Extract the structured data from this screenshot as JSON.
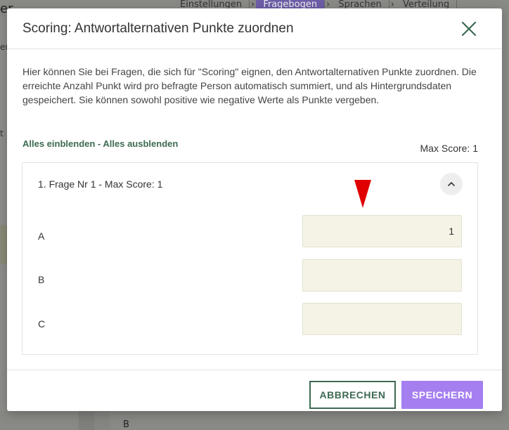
{
  "background": {
    "title_fragment": "er",
    "tabs": [
      "Einstellungen",
      "Fragebogen",
      "Sprachen",
      "Verteilung"
    ],
    "active_tab": 1,
    "side_text_1": "er",
    "side_text_2": "t",
    "bottom_text": "B"
  },
  "modal": {
    "title": "Scoring: Antwortalternativen Punkte zuordnen",
    "intro": "Hier können Sie bei Fragen, die sich für \"Scoring\" eignen, den Antwortalternativen Punkte zuordnen. Die erreichte Anzahl Punkt wird pro befragte Person automatisch summiert, und als Hintergrundsdaten gespeichert. Sie können sowohl positive wie negative Werte als Punkte vergeben.",
    "show_all": "Alles einblenden",
    "separator": " - ",
    "hide_all": "Alles ausblenden",
    "max_score_total": "Max Score: 1",
    "question": {
      "title": "1. Frage Nr 1 - Max Score: 1",
      "answers": [
        {
          "label": "A",
          "value": "1"
        },
        {
          "label": "B",
          "value": ""
        },
        {
          "label": "C",
          "value": ""
        }
      ]
    },
    "cancel_label": "ABBRECHEN",
    "save_label": "SPEICHERN"
  },
  "colors": {
    "accent_green": "#3d6a52",
    "save_purple": "#a57ff0",
    "input_bg": "#f4f3e6",
    "marker_red": "#e00000"
  },
  "icons": {
    "close": "close-icon",
    "collapse": "chevron-up-icon"
  }
}
